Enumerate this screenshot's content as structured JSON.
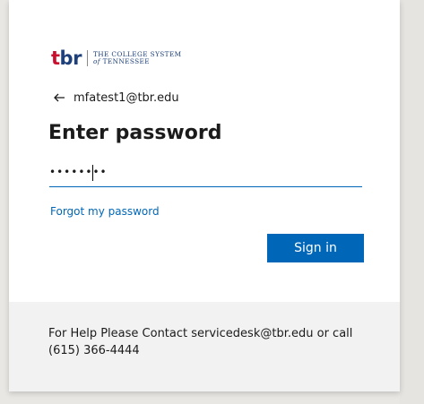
{
  "branding": {
    "logo_wordmark": "tbr",
    "logo_line1": "THE COLLEGE SYSTEM",
    "logo_line2_prefix": "of",
    "logo_line2": "TENNESSEE"
  },
  "identity": {
    "back_icon": "arrow-left-icon",
    "email": "mfatest1@tbr.edu"
  },
  "form": {
    "title": "Enter password",
    "password_value": "••••••••",
    "forgot_label": "Forgot my password",
    "signin_label": "Sign in"
  },
  "footer": {
    "help_text": "For Help Please Contact servicedesk@tbr.edu or call (615) 366-4444"
  },
  "colors": {
    "accent": "#0067b8",
    "brand_blue": "#1d3f7a",
    "brand_red": "#c8102e",
    "footer_bg": "#f2f2f2"
  }
}
